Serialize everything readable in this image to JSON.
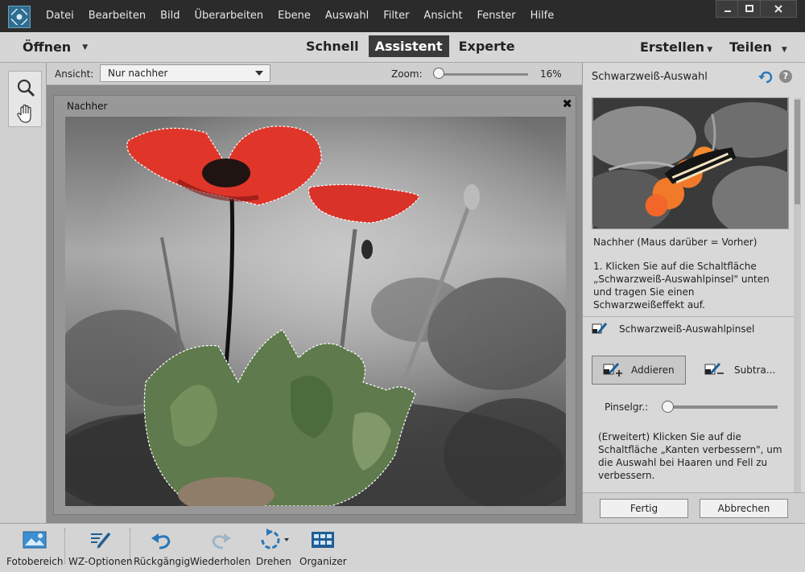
{
  "menubar": {
    "items": [
      "Datei",
      "Bearbeiten",
      "Bild",
      "Überarbeiten",
      "Ebene",
      "Auswahl",
      "Filter",
      "Ansicht",
      "Fenster",
      "Hilfe"
    ],
    "app_icon": "elements-logo-icon",
    "window_controls": [
      "minimize-icon",
      "maximize-icon",
      "close-icon"
    ]
  },
  "modebar": {
    "open_label": "Öffnen",
    "modes": [
      "Schnell",
      "Assistent",
      "Experte"
    ],
    "active_mode": "Assistent",
    "create_label": "Erstellen",
    "share_label": "Teilen"
  },
  "tools": [
    "zoom-icon",
    "hand-icon"
  ],
  "options": {
    "view_label": "Ansicht:",
    "view_value": "Nur nachher",
    "zoom_label": "Zoom:",
    "zoom_value": "16%",
    "zoom_fraction": 0.0
  },
  "document": {
    "title": "Nachher"
  },
  "panel": {
    "title": "Schwarzweiß-Auswahl",
    "preview_caption": "Nachher (Maus darüber = Vorher)",
    "step1": "1. Klicken Sie auf die Schaltfläche „Schwarzweiß-Auswahlpinsel\" unten und tragen Sie einen Schwarzweißeffekt auf.",
    "brush_tool_label": "Schwarzweiß-Auswahlpinsel",
    "add_label": "Addieren",
    "subtract_label": "Subtra...",
    "brush_size_label": "Pinselgr.:",
    "brush_size_fraction": 0.0,
    "step2": "(Erweitert) Klicken Sie auf die Schaltfläche „Kanten verbessern\", um die Auswahl bei Haaren und Fell zu verbessern.",
    "done_label": "Fertig",
    "cancel_label": "Abbrechen"
  },
  "bottombar": {
    "items": [
      {
        "label": "Fotobereich",
        "icon": "photo-bin-icon"
      },
      {
        "label": "WZ-Optionen",
        "icon": "tool-options-icon"
      },
      {
        "label": "Rückgängig",
        "icon": "undo-icon"
      },
      {
        "label": "Wiederholen",
        "icon": "redo-icon"
      },
      {
        "label": "Drehen",
        "icon": "rotate-icon"
      },
      {
        "label": "Organizer",
        "icon": "organizer-icon"
      }
    ]
  },
  "colors": {
    "accent": "#2f6d8f",
    "menubar_bg": "#2b2b2b",
    "panel_bg": "#d8d8d8",
    "canvas_bg": "#8b8b8b",
    "poppy_red": "#e0362a",
    "preview_orange": "#f07a2a"
  }
}
